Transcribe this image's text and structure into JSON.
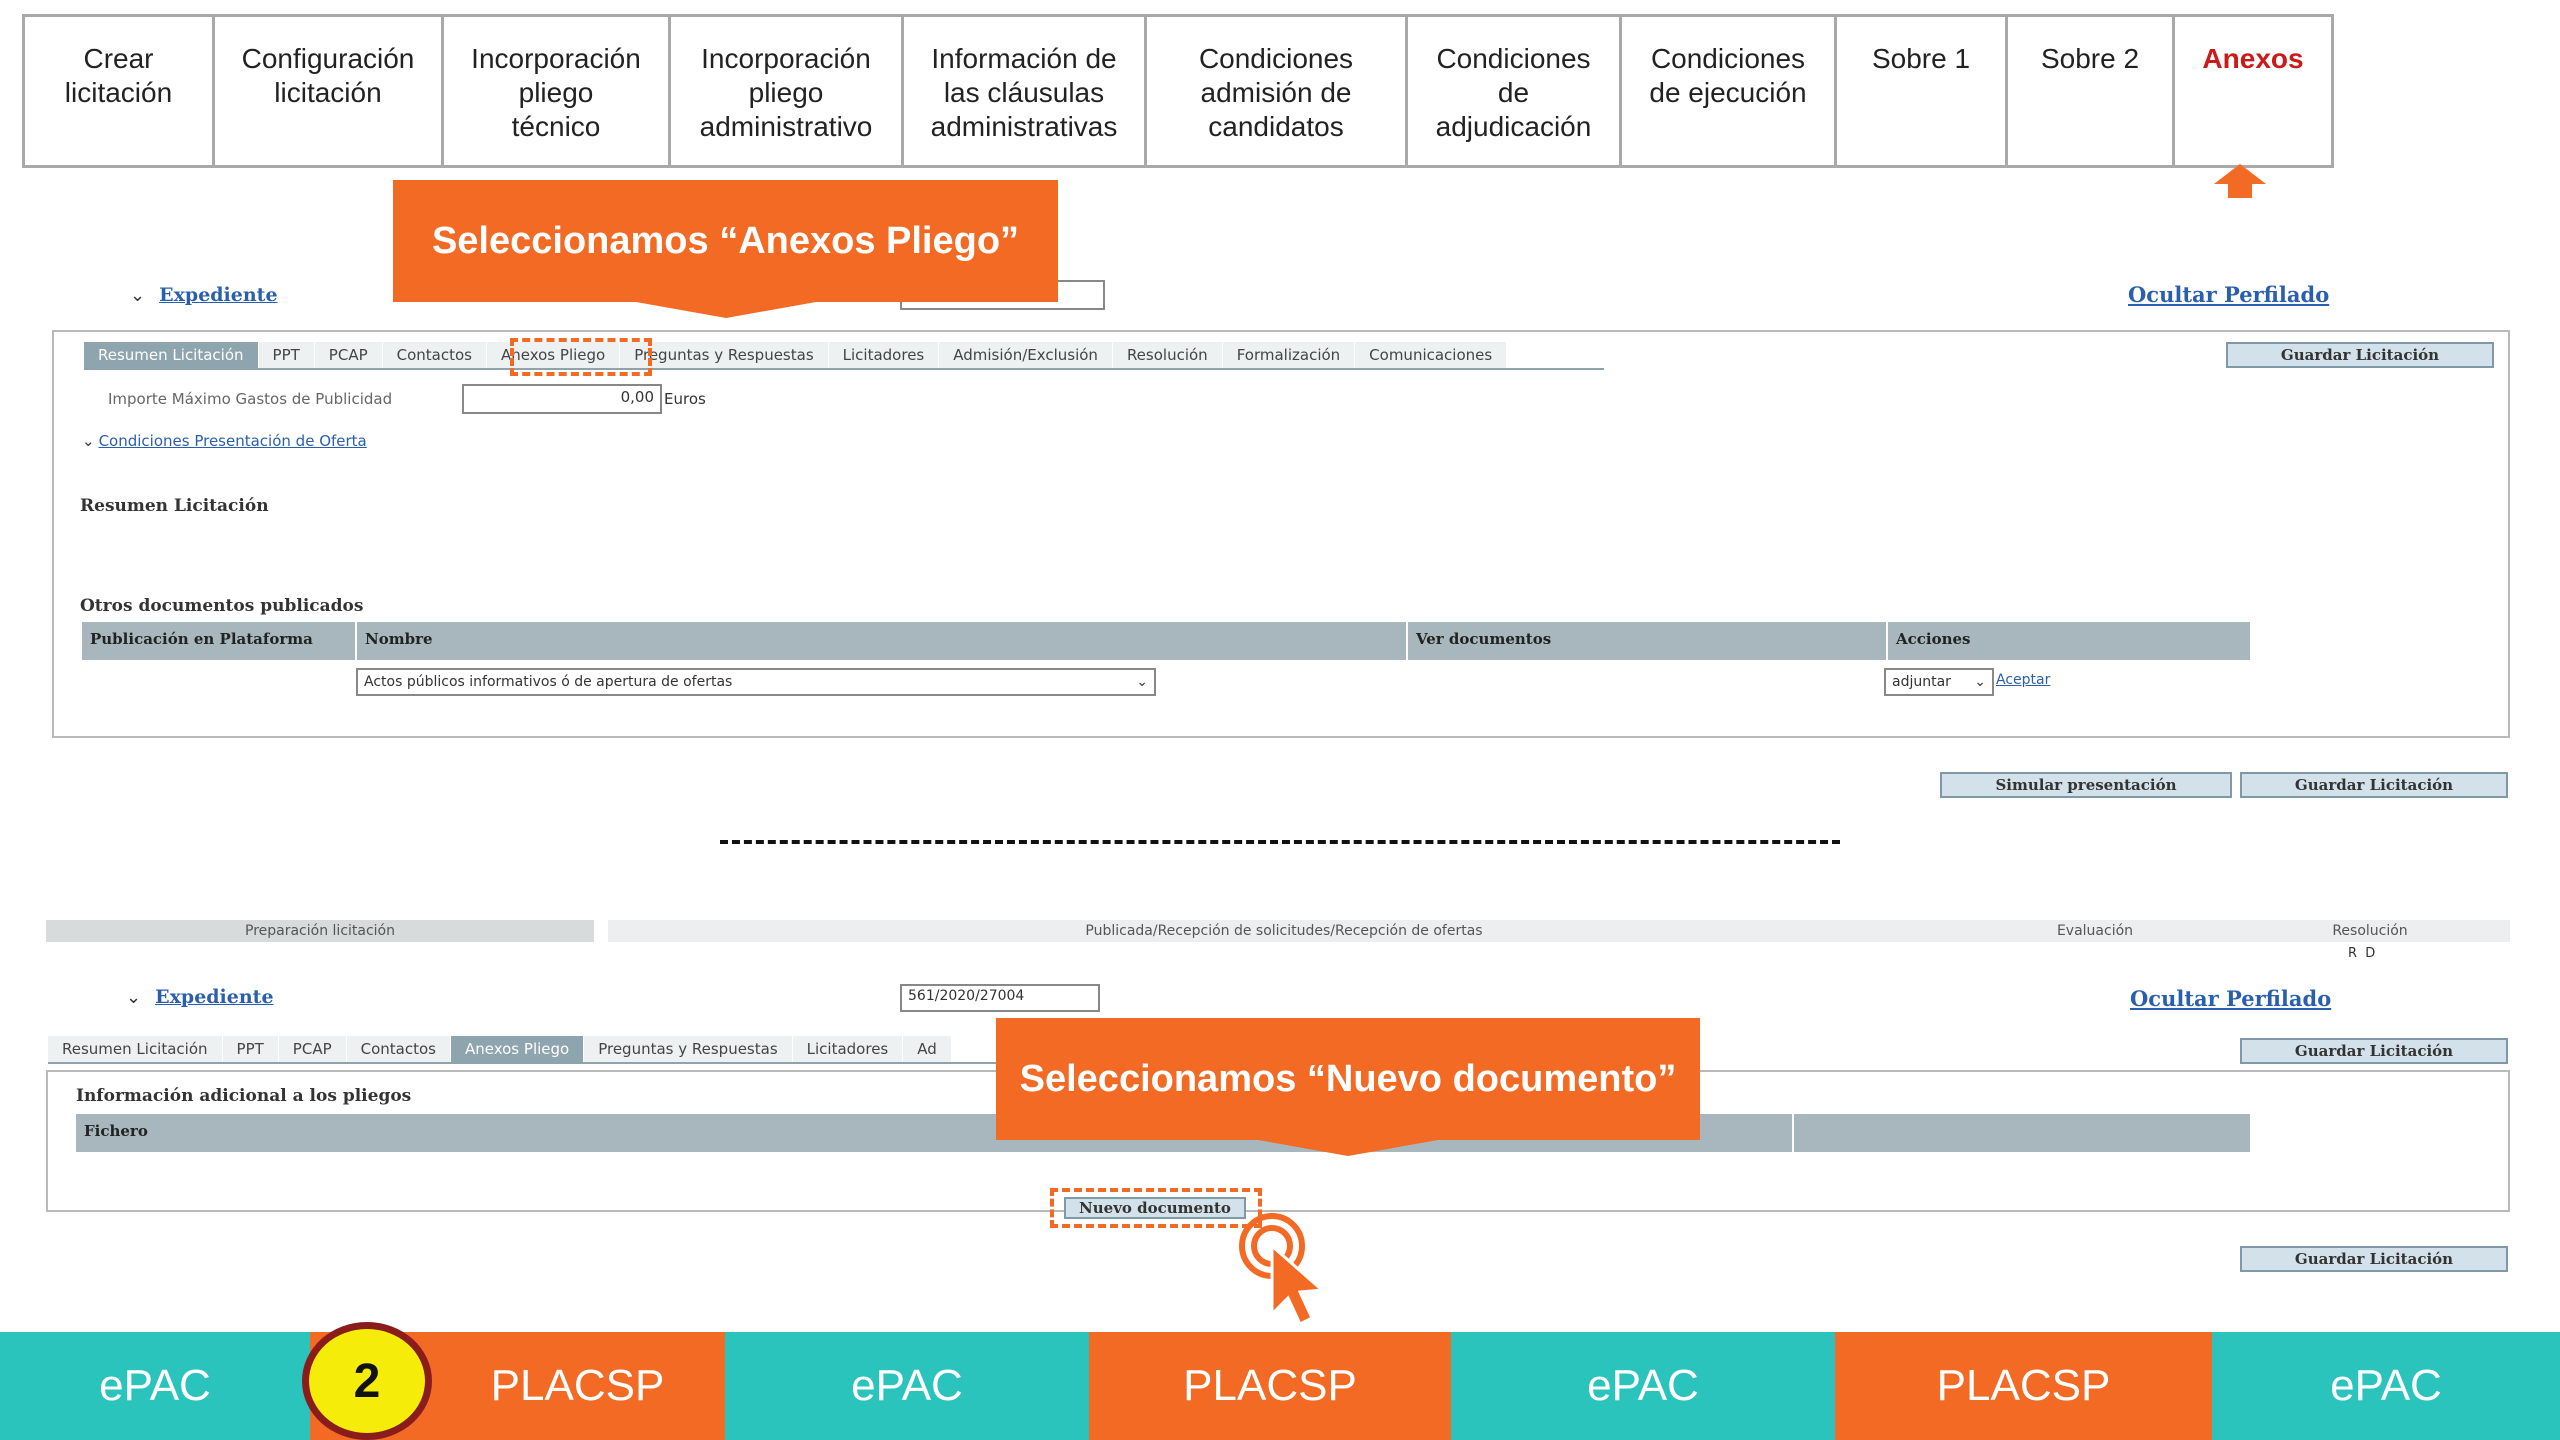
{
  "steps": [
    "Crear\nlicitación",
    "Configuración\nlicitación",
    "Incorporación\npliego\ntécnico",
    "Incorporación\npliego\nadministrativo",
    "Información de\nlas cláusulas\nadministrativas",
    "Condiciones\nadmisión de\ncandidatos",
    "Condiciones\nde\nadjudicación",
    "Condiciones\nde ejecución",
    "Sobre 1",
    "Sobre 2",
    "Anexos"
  ],
  "active_step": "Anexos",
  "callout1": "Seleccionamos “Anexos Pliego”",
  "callout2": "Seleccionamos “Nuevo documento”",
  "shot1": {
    "expediente_label": "Expediente",
    "ocultar": "Ocultar Perfilado",
    "tabs": [
      "Resumen Licitación",
      "PPT",
      "PCAP",
      "Contactos",
      "Anexos Pliego",
      "Preguntas y Respuestas",
      "Licitadores",
      "Admisión/Exclusión",
      "Resolución",
      "Formalización",
      "Comunicaciones"
    ],
    "guardar": "Guardar Licitación",
    "importe_label": "Importe Máximo Gastos de Publicidad",
    "importe_value": "0,00",
    "importe_unit": "Euros",
    "condiciones_link": "Condiciones Presentación de Oferta",
    "resumen_heading": "Resumen Licitación",
    "otros_heading": "Otros documentos publicados",
    "columns": [
      "Publicación en Plataforma",
      "Nombre",
      "Ver documentos",
      "Acciones"
    ],
    "nombre_select": "Actos públicos informativos ó de apertura de ofertas",
    "accion_select": "adjuntar",
    "aceptar": "Aceptar",
    "simular": "Simular presentación",
    "guardar2": "Guardar Licitación"
  },
  "shot2": {
    "phases": [
      "Preparación licitación",
      "Publicada/Recepción de solicitudes/Recepción de ofertas",
      "Evaluación",
      "Resolución"
    ],
    "rd": "R  D",
    "expediente_label": "Expediente",
    "expediente_value": "561/2020/27004",
    "ocultar": "Ocultar Perfilado",
    "tabs": [
      "Resumen Licitación",
      "PPT",
      "PCAP",
      "Contactos",
      "Anexos Pliego",
      "Preguntas y Respuestas",
      "Licitadores",
      "Ad"
    ],
    "guardar": "Guardar Licitación",
    "info_heading": "Información adicional a los pliegos",
    "fichero": "Fichero",
    "nuevo": "Nuevo documento",
    "guardar2": "Guardar Licitación"
  },
  "bottom_bar": [
    "ePAC",
    "PLACSP",
    "ePAC",
    "PLACSP",
    "ePAC",
    "PLACSP",
    "ePAC"
  ],
  "step_badge": "2",
  "colors": {
    "accent": "#f26a24",
    "teal": "#2bc4bd",
    "active_red": "#cc1a1a",
    "badge_yellow": "#f5ec0a",
    "badge_ring": "#8b1c1c"
  }
}
